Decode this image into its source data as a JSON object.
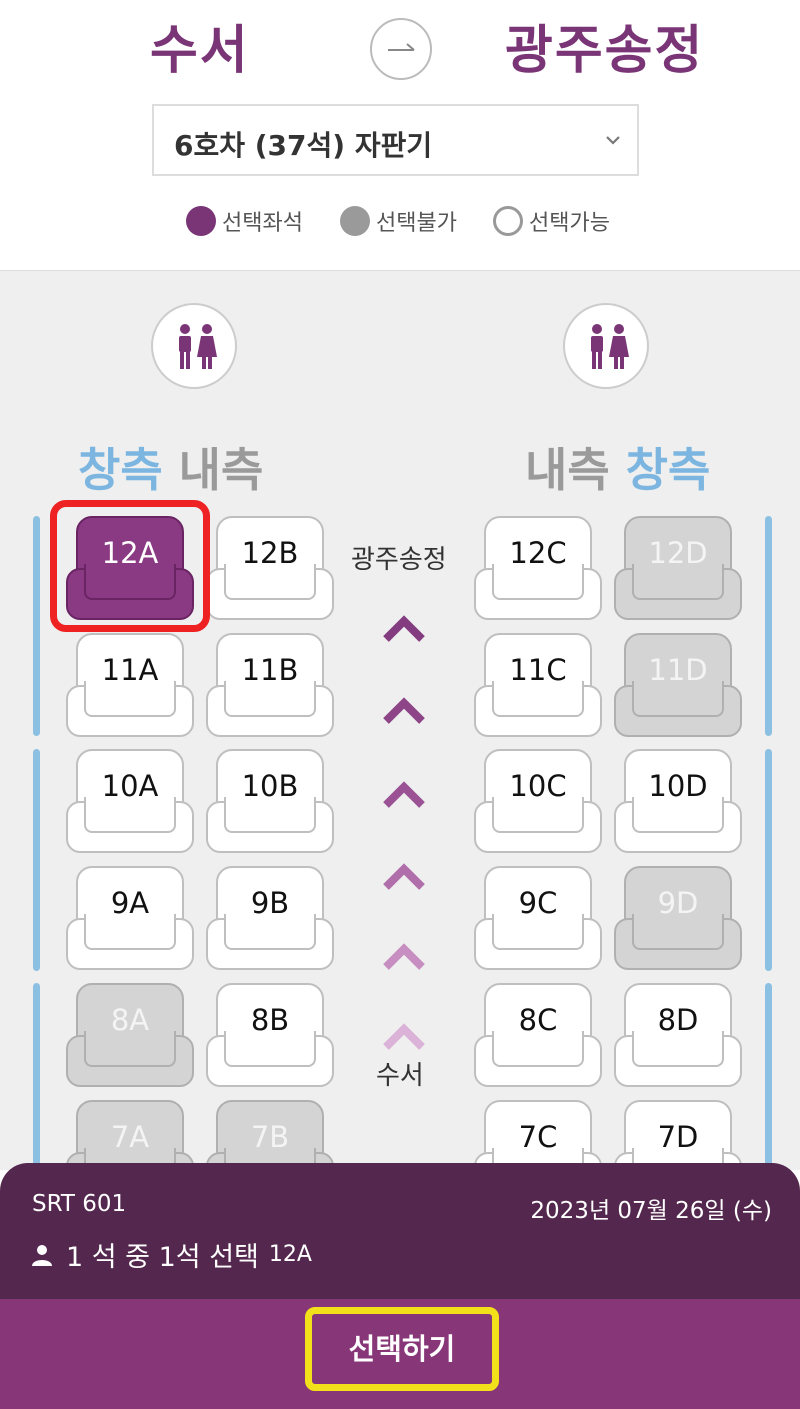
{
  "route": {
    "from": "수서",
    "to": "광주송정"
  },
  "car_select": {
    "value": "6호차 (37석) 자판기"
  },
  "legend": [
    {
      "label": "선택좌석",
      "color": "#7a3577"
    },
    {
      "label": "선택불가",
      "color": "#9a9a9a"
    },
    {
      "label": "선택가능",
      "color": "#ffffff"
    }
  ],
  "side_labels": {
    "left": {
      "window": "창측",
      "aisle": "내측"
    },
    "right": {
      "aisle": "내측",
      "window": "창측"
    }
  },
  "direction": {
    "top": "광주송정",
    "bottom": "수서"
  },
  "seats": {
    "r12": [
      "12A",
      "12B",
      "12C",
      "12D"
    ],
    "r11": [
      "11A",
      "11B",
      "11C",
      "11D"
    ],
    "r10": [
      "10A",
      "10B",
      "10C",
      "10D"
    ],
    "r9": [
      "9A",
      "9B",
      "9C",
      "9D"
    ],
    "r8": [
      "8A",
      "8B",
      "8C",
      "8D"
    ],
    "r7": [
      "7A",
      "7B",
      "7C",
      "7D"
    ]
  },
  "seat_status": {
    "selected": [
      "12A"
    ],
    "unavailable": [
      "12D",
      "11D",
      "9D",
      "8A",
      "7A",
      "7B"
    ]
  },
  "summary": {
    "train": "SRT 601",
    "date": "2023년 07월 26일 (수)",
    "selection": "1 석 중 1석 선택",
    "selected_seat": "12A"
  },
  "action": {
    "label": "선택하기"
  },
  "colors": {
    "brand": "#873778",
    "dark": "#54284e",
    "window": "#7cb6e0"
  }
}
